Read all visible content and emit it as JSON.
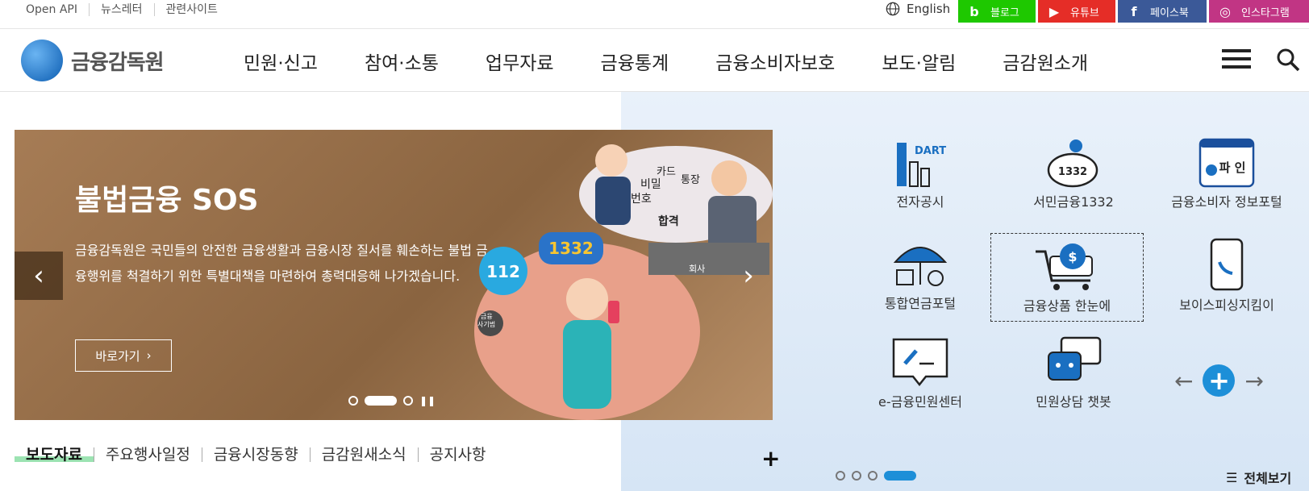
{
  "utility": {
    "links": [
      "Open API",
      "뉴스레터",
      "관련사이트"
    ],
    "language": "English"
  },
  "sns": [
    {
      "label": "블로그",
      "glyph": "b",
      "color": "#1ec800"
    },
    {
      "label": "유튜브",
      "glyph": "▶",
      "color": "#e52d27"
    },
    {
      "label": "페이스북",
      "glyph": "f",
      "color": "#3b5998"
    },
    {
      "label": "인스타그램",
      "glyph": "◎",
      "color": "#c13584"
    }
  ],
  "header": {
    "logo_text": "금융감독원",
    "nav": [
      "민원·신고",
      "참여·소통",
      "업무자료",
      "금융통계",
      "금융소비자보호",
      "보도·알림",
      "금감원소개"
    ]
  },
  "slider": {
    "title": "불법금융 SOS",
    "description": "금융감독원은 국민들의 안전한 금융생활과 금융시장 질서를 훼손하는 불법 금융행위를 척결하기 위한 특별대책을 마련하여 총력대응해 나가겠습니다.",
    "button": "바로가기",
    "bubble_a": "112",
    "bubble_b": "1332",
    "illust_words": [
      "비밀",
      "번호",
      "카드",
      "통장",
      "합격",
      "회사",
      "금융",
      "사기범"
    ]
  },
  "quick_links": [
    {
      "label": "전자공시",
      "icon": "dart-icon",
      "badge": "DART"
    },
    {
      "label": "서민금융1332",
      "icon": "piggy-bank-icon",
      "badge": "1332"
    },
    {
      "label": "금융소비자 정보포털",
      "icon": "fine-portal-icon",
      "badge": "파 인"
    },
    {
      "label": "통합연금포털",
      "icon": "umbrella-icon"
    },
    {
      "label": "금융상품 한눈에",
      "icon": "shopping-cart-icon"
    },
    {
      "label": "보이스피싱지킴이",
      "icon": "phone-icon"
    },
    {
      "label": "e-금융민원센터",
      "icon": "pen-bubble-icon"
    },
    {
      "label": "민원상담 챗봇",
      "icon": "chatbot-icon"
    }
  ],
  "view_all": "전체보기",
  "news_tabs": [
    "보도자료",
    "주요행사일정",
    "금융시장동향",
    "금감원새소식",
    "공지사항"
  ],
  "colors": {
    "accent_blue": "#1d8fd8",
    "tab_highlight": "#9ce3b2"
  }
}
